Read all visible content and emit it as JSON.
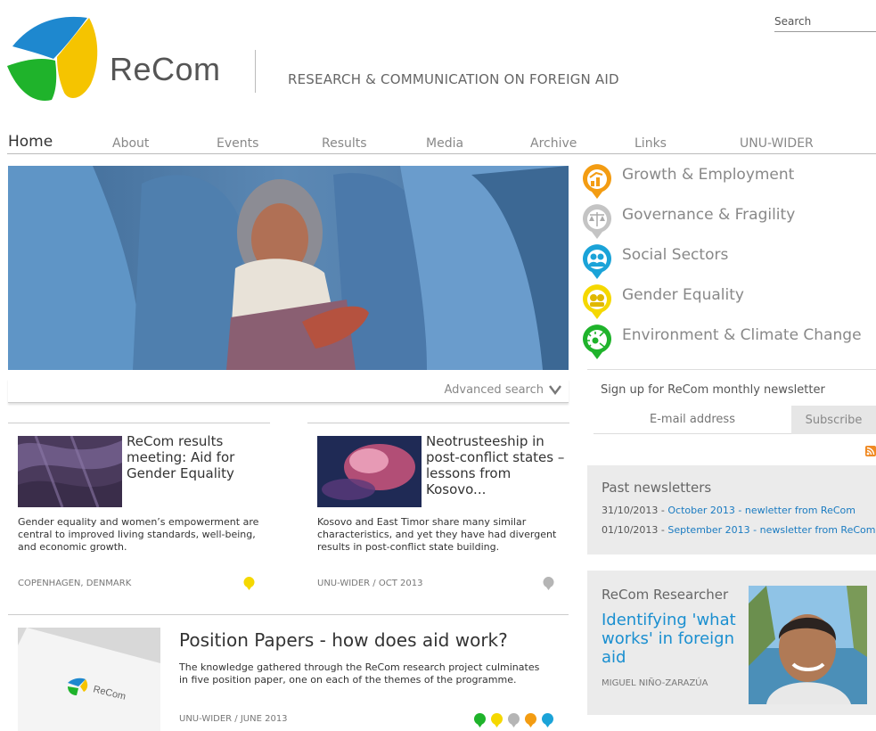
{
  "header": {
    "brand": "ReCom",
    "tagline": "RESEARCH & COMMUNICATION ON FOREIGN AID",
    "search_label": "Search"
  },
  "nav": {
    "items": [
      {
        "label": "Home",
        "active": true
      },
      {
        "label": "About"
      },
      {
        "label": "Events"
      },
      {
        "label": "Results"
      },
      {
        "label": "Media"
      },
      {
        "label": "Archive"
      },
      {
        "label": "Links"
      },
      {
        "label": "UNU-WIDER"
      }
    ]
  },
  "hero": {
    "advanced_search": "Advanced search",
    "chevron_icon": "chevron-down-icon"
  },
  "themes": [
    {
      "label": "Growth & Employment",
      "icon": "growth-chart-icon",
      "color": "#f39c12"
    },
    {
      "label": "Governance & Fragility",
      "icon": "scales-icon",
      "color": "#b5b5b5"
    },
    {
      "label": "Social Sectors",
      "icon": "people-icon",
      "color": "#1ba3d8"
    },
    {
      "label": "Gender Equality",
      "icon": "gender-icon",
      "color": "#f5d800"
    },
    {
      "label": "Environment & Climate Change",
      "icon": "sun-leaf-icon",
      "color": "#1fb32b"
    }
  ],
  "newsletter": {
    "title": "Sign up for ReCom monthly newsletter",
    "email_placeholder": "E-mail address",
    "subscribe_label": "Subscribe",
    "rss_icon": "rss-icon"
  },
  "past_newsletters": {
    "title": "Past newsletters",
    "items": [
      {
        "date": "31/10/2013",
        "sep": " - ",
        "link": "October 2013 - newletter from ReCom"
      },
      {
        "date": "01/10/2013",
        "sep": " - ",
        "link": "September 2013 - newsletter from ReCom"
      }
    ]
  },
  "researcher": {
    "title": "ReCom Researcher",
    "link": "Identifying 'what works' in foreign aid",
    "name": "MIGUEL NIÑO-ZARAZÚA"
  },
  "articles": [
    {
      "title": "ReCom results meeting: Aid for Gender Equality",
      "description": "Gender equality and women’s empowerment are central to improved living standards, well-being, and economic growth.",
      "meta": "COPENHAGEN, DENMARK",
      "theme_color": "#f5d800"
    },
    {
      "title": "Neotrusteeship in post-conflict states – lessons from Kosovo...",
      "description": "Kosovo and East Timor share many similar characteristics, and yet they have had divergent results in post-conflict state building.",
      "meta": "UNU-WIDER / OCT 2013",
      "theme_color": "#b5b5b5"
    }
  ],
  "position_papers": {
    "title": "Position Papers - how does aid work?",
    "description": "The knowledge gathered through the ReCom research project culminates in five position paper, one on each of the themes of the programme.",
    "meta": "UNU-WIDER / JUNE 2013",
    "theme_colors": [
      "#1fb32b",
      "#f5d800",
      "#b5b5b5",
      "#f39c12",
      "#1ba3d8"
    ],
    "thumb_brand": "ReCom"
  }
}
